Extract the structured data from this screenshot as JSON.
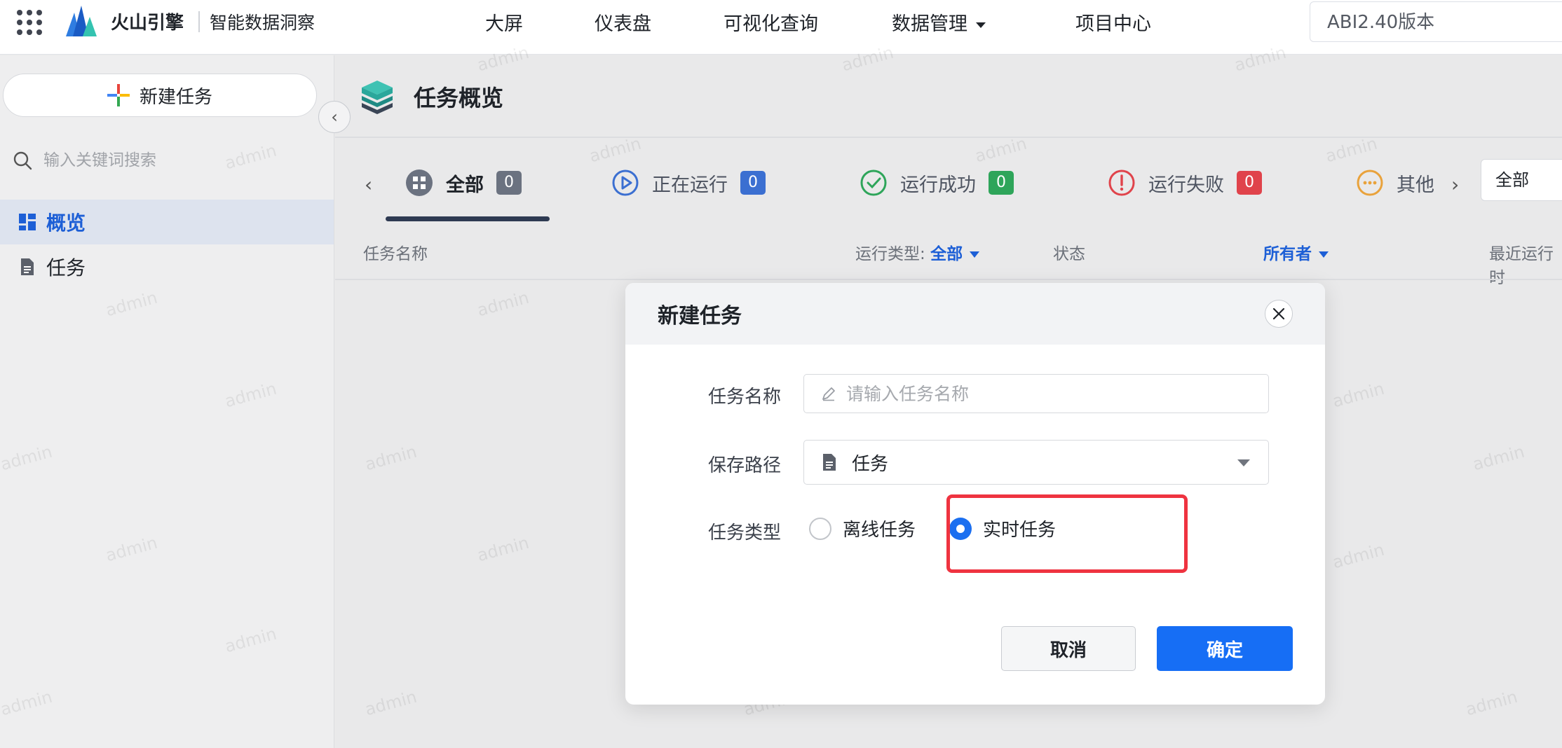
{
  "topbar": {
    "brand_name": "火山引擎",
    "brand_sub": "智能数据洞察",
    "nav": [
      "大屏",
      "仪表盘",
      "可视化查询",
      "数据管理",
      "项目中心"
    ],
    "version": "ABI2.40版本"
  },
  "sidebar": {
    "new_task": "新建任务",
    "search_placeholder": "输入关键词搜索",
    "items": [
      {
        "label": "概览",
        "icon": "dashboard-icon",
        "active": true
      },
      {
        "label": "任务",
        "icon": "document-icon",
        "active": false
      }
    ]
  },
  "main": {
    "title": "任务概览",
    "tabs": [
      {
        "label": "全部",
        "count": "0",
        "badge_color": "#6b7280"
      },
      {
        "label": "正在运行",
        "count": "0",
        "badge_color": "#3b6fd1"
      },
      {
        "label": "运行成功",
        "count": "0",
        "badge_color": "#2ea55a"
      },
      {
        "label": "运行失败",
        "count": "0",
        "badge_color": "#e0434b"
      },
      {
        "label": "其他"
      }
    ],
    "filter_value": "全部",
    "columns": {
      "name": "任务名称",
      "run_type_label": "运行类型:",
      "run_type_value": "全部",
      "status": "状态",
      "owner": "所有者",
      "recent": "最近运行时"
    },
    "watermark": "admin"
  },
  "dialog": {
    "title": "新建任务",
    "name_label": "任务名称",
    "name_placeholder": "请输入任务名称",
    "path_label": "保存路径",
    "path_value": "任务",
    "type_label": "任务类型",
    "type_options": [
      "离线任务",
      "实时任务"
    ],
    "selected_type": "实时任务",
    "cancel": "取消",
    "confirm": "确定",
    "highlight_color": "#ef3340",
    "accent_color": "#166ef5"
  }
}
